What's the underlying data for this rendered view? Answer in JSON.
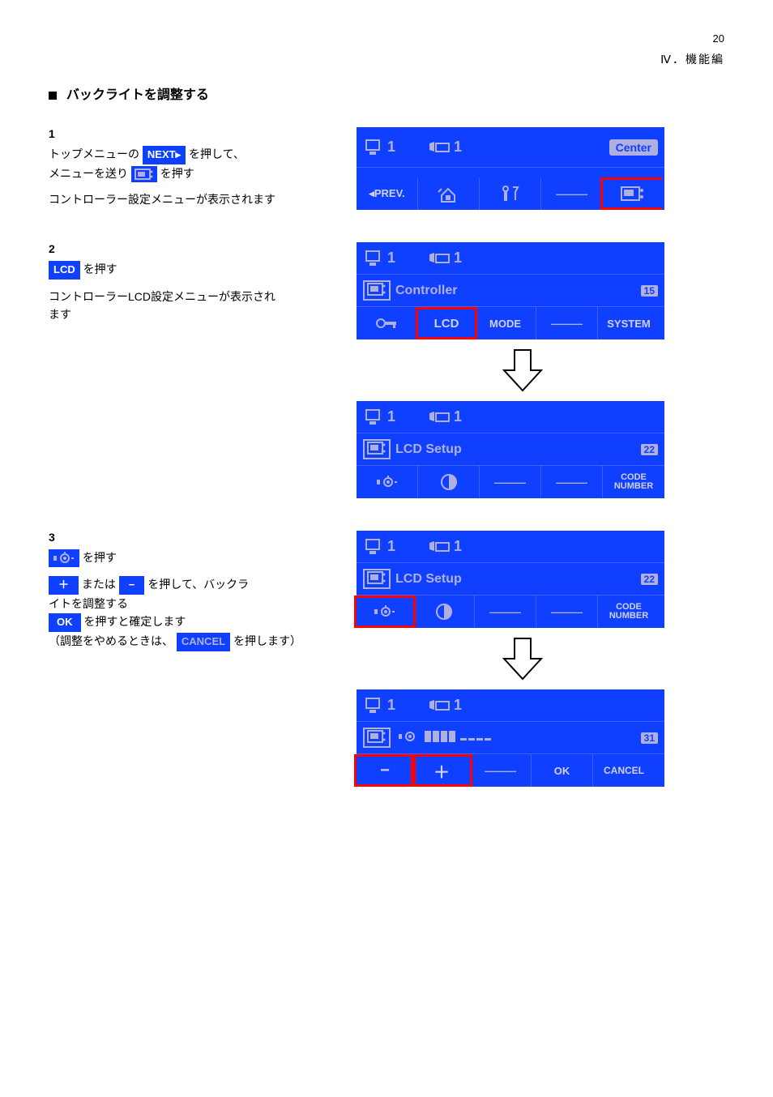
{
  "page_number": "20",
  "header": "Ⅳ．機能編",
  "section_title": "バックライトを調整する",
  "steps": {
    "s1": {
      "num": "1",
      "line1": "トップメニューの",
      "next_label": "NEXT▸",
      "line1b": "を押して、",
      "line2": "メニューを送り",
      "line2b": "を押す",
      "line3": "コントローラー設定メニューが表示されます"
    },
    "s2": {
      "num": "2",
      "lcd_label": "LCD",
      "line1": "を押す",
      "line2": "コントローラーLCD設定メニューが表示され",
      "line3": "ます"
    },
    "s3": {
      "num": "3",
      "line1": "を押す",
      "line2": "または",
      "plus": "＋",
      "minus": "−",
      "line2b": "を押して、バックラ",
      "line3": "イトを調整する",
      "ok": "OK",
      "line4": "を押すと確定します",
      "cancel": "CANCEL",
      "line5": "（調整をやめるときは、",
      "line5b": "を押します）"
    }
  },
  "lcd": {
    "top1": "1",
    "top2": "1",
    "center": "Center",
    "prev": "◂PREV.",
    "controller": "Controller",
    "p15": "15",
    "lcd": "LCD",
    "mode": "MODE",
    "dash": "———",
    "system": "SYSTEM",
    "lcdsetup": "LCD Setup",
    "p22": "22",
    "codenumber1": "CODE",
    "codenumber2": "NUMBER",
    "p31": "31",
    "minus": "−",
    "plus": "＋",
    "ok": "OK",
    "cancel": "CANCEL"
  }
}
